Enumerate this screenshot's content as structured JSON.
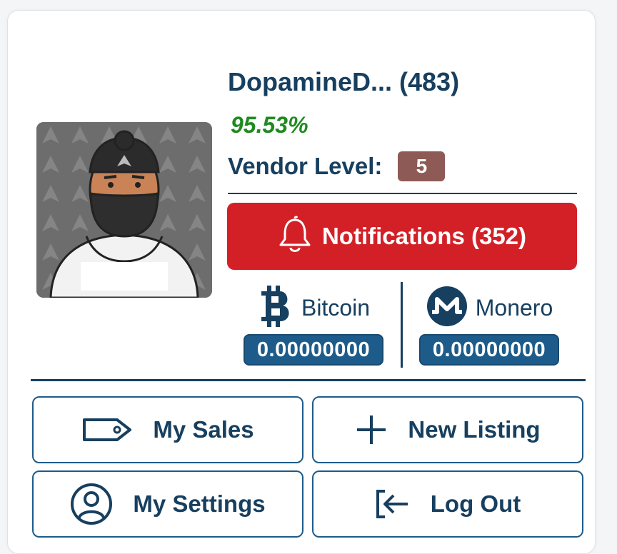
{
  "profile": {
    "username": "DopamineD... (483)",
    "rating": "95.53%",
    "vendor_level_label": "Vendor Level:",
    "vendor_level": "5"
  },
  "notifications": {
    "label": "Notifications (352)",
    "icon": "bell-icon"
  },
  "wallets": [
    {
      "name": "Bitcoin",
      "balance": "0.00000000",
      "icon": "bitcoin-icon"
    },
    {
      "name": "Monero",
      "balance": "0.00000000",
      "icon": "monero-icon"
    }
  ],
  "actions": {
    "my_sales": "My Sales",
    "new_listing": "New Listing",
    "my_settings": "My Settings",
    "log_out": "Log Out"
  },
  "colors": {
    "primary": "#173f5f",
    "notification": "#d32027",
    "rating": "#1f8a1f",
    "level_badge": "#8e5a55",
    "balance": "#1d5c8a"
  }
}
